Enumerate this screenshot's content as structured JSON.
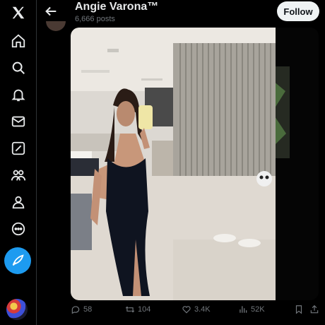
{
  "header": {
    "title": "Angie Varona™",
    "subtitle": "6,666 posts",
    "follow_label": "Follow"
  },
  "nav": {
    "items": [
      "x-logo-icon",
      "home-icon",
      "search-icon",
      "notifications-icon",
      "messages-icon",
      "grok-icon",
      "communities-icon",
      "profile-icon",
      "more-icon"
    ]
  },
  "actions": {
    "replies": "58",
    "reposts": "104",
    "likes": "3.4K",
    "views": "52K"
  },
  "colors": {
    "accent": "#1d9bf0",
    "muted": "#71767b",
    "text": "#e7e9ea"
  }
}
